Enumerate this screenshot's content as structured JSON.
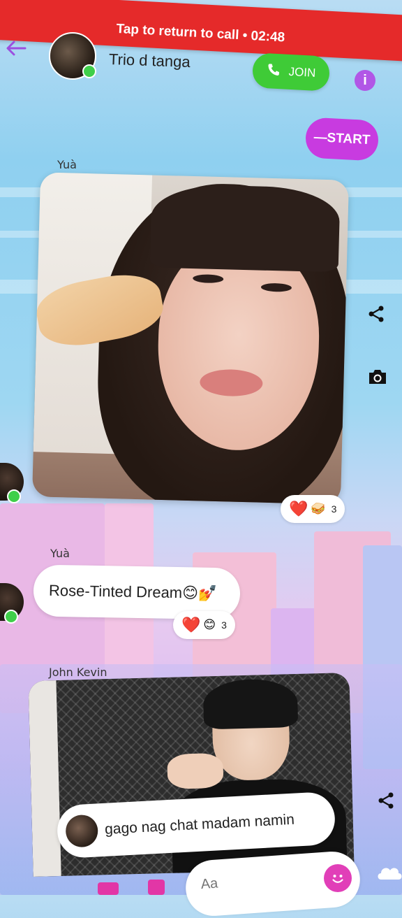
{
  "call_banner": {
    "text": "Tap to return to call • 02:48"
  },
  "header": {
    "title": "Trio d tanga",
    "join_label": "JOIN",
    "start_label": "—START",
    "accent_color": "#9b4fe0"
  },
  "messages": [
    {
      "sender": "Yuà",
      "type": "photo",
      "reaction": {
        "emojis": [
          "❤️",
          "🥪"
        ],
        "count": "3"
      }
    },
    {
      "sender": "Yuà",
      "type": "text",
      "text": "Rose-Tinted Dream😊💅",
      "reaction": {
        "emojis": [
          "❤️",
          "😊"
        ],
        "count": "3"
      }
    },
    {
      "sender": "John Kevin",
      "type": "photo",
      "caption": "gago nag chat madam namin"
    }
  ],
  "composer": {
    "placeholder": "Aa"
  },
  "colors": {
    "join_green": "#3fcb37",
    "start_magenta": "#c83be0",
    "banner_red": "#e52a2a"
  },
  "icons": [
    "back-arrow-icon",
    "info-icon",
    "phone-icon",
    "share-icon",
    "camera-icon",
    "emoji-icon",
    "cloud-icon"
  ]
}
